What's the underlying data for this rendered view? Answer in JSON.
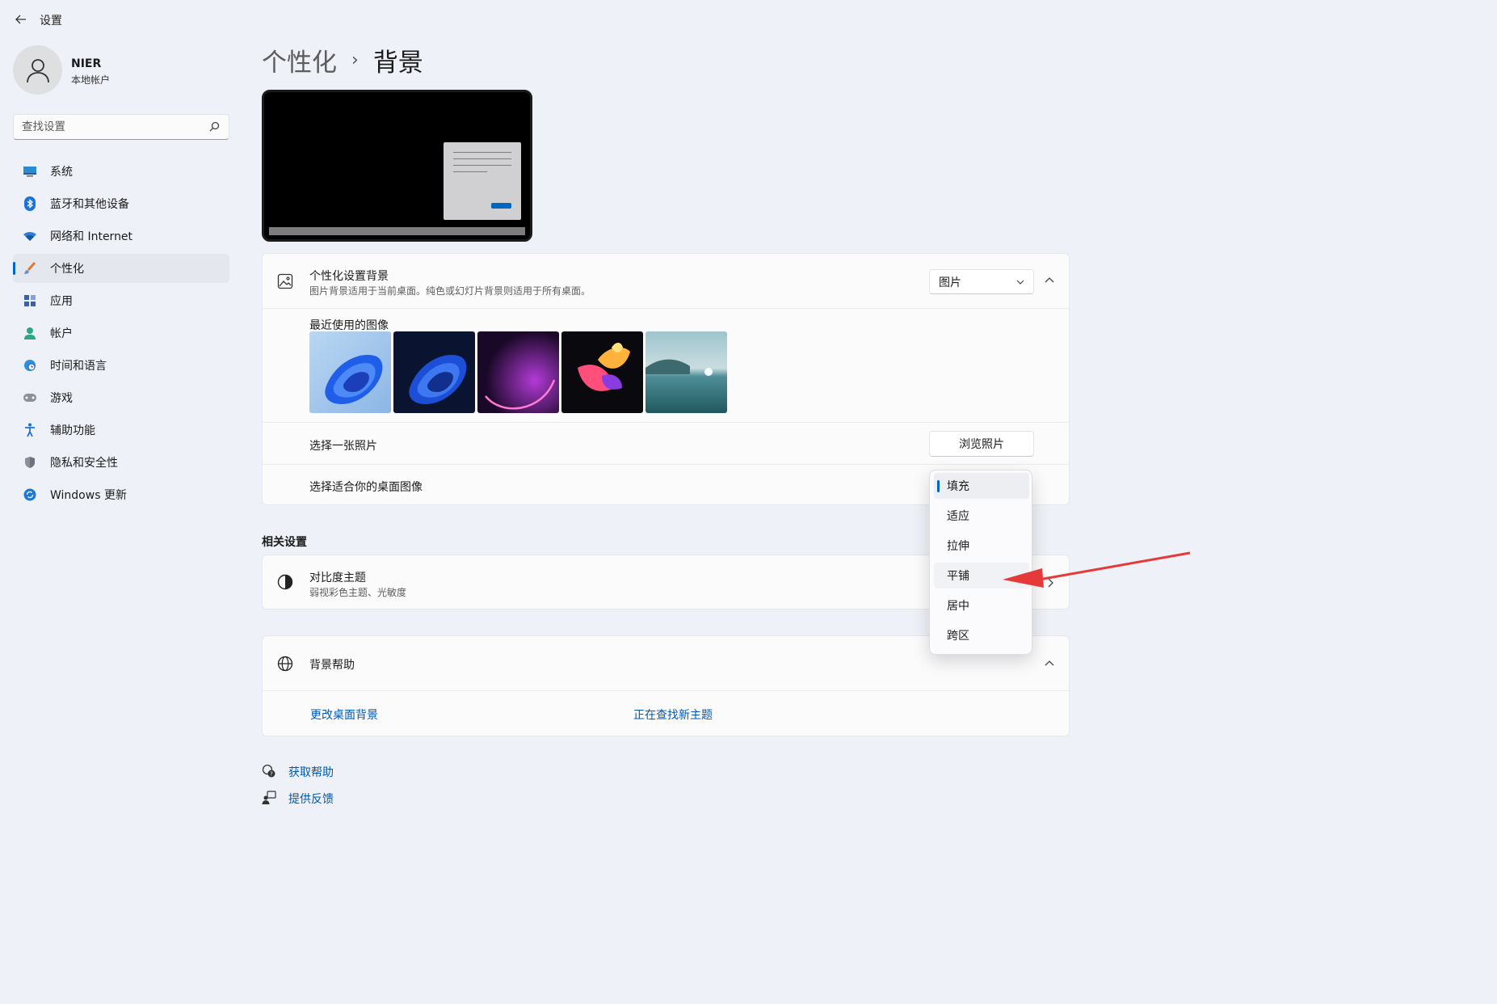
{
  "app": {
    "title": "设置"
  },
  "user": {
    "name": "NIER",
    "account_type": "本地帐户"
  },
  "search": {
    "placeholder": "查找设置"
  },
  "nav": {
    "items": [
      {
        "label": "系统",
        "icon": "monitor-icon"
      },
      {
        "label": "蓝牙和其他设备",
        "icon": "bluetooth-icon"
      },
      {
        "label": "网络和 Internet",
        "icon": "wifi-icon"
      },
      {
        "label": "个性化",
        "icon": "brush-icon",
        "active": true
      },
      {
        "label": "应用",
        "icon": "apps-icon"
      },
      {
        "label": "帐户",
        "icon": "person-icon"
      },
      {
        "label": "时间和语言",
        "icon": "globe-clock-icon"
      },
      {
        "label": "游戏",
        "icon": "gamepad-icon"
      },
      {
        "label": "辅助功能",
        "icon": "accessibility-icon"
      },
      {
        "label": "隐私和安全性",
        "icon": "shield-icon"
      },
      {
        "label": "Windows 更新",
        "icon": "update-icon"
      }
    ]
  },
  "breadcrumb": {
    "parent": "个性化",
    "separator": "›",
    "current": "背景"
  },
  "background_card": {
    "title": "个性化设置背景",
    "subtitle": "图片背景适用于当前桌面。纯色或幻灯片背景则适用于所有桌面。",
    "type_value": "图片",
    "recent_label": "最近使用的图像",
    "choose_photo_label": "选择一张照片",
    "browse_button": "浏览照片",
    "fit_label": "选择适合你的桌面图像"
  },
  "fit_options": {
    "items": [
      "填充",
      "适应",
      "拉伸",
      "平铺",
      "居中",
      "跨区"
    ],
    "selected": "填充",
    "hovered": "平铺"
  },
  "related": {
    "heading": "相关设置",
    "contrast_title": "对比度主题",
    "contrast_subtitle": "弱视彩色主题、光敏度"
  },
  "help_card": {
    "title": "背景帮助",
    "link1": "更改桌面背景",
    "link2": "正在查找新主题"
  },
  "footer": {
    "get_help": "获取帮助",
    "feedback": "提供反馈"
  },
  "colors": {
    "accent": "#0067c0",
    "arrow": "#e53a3a",
    "background": "#eef1f7"
  }
}
